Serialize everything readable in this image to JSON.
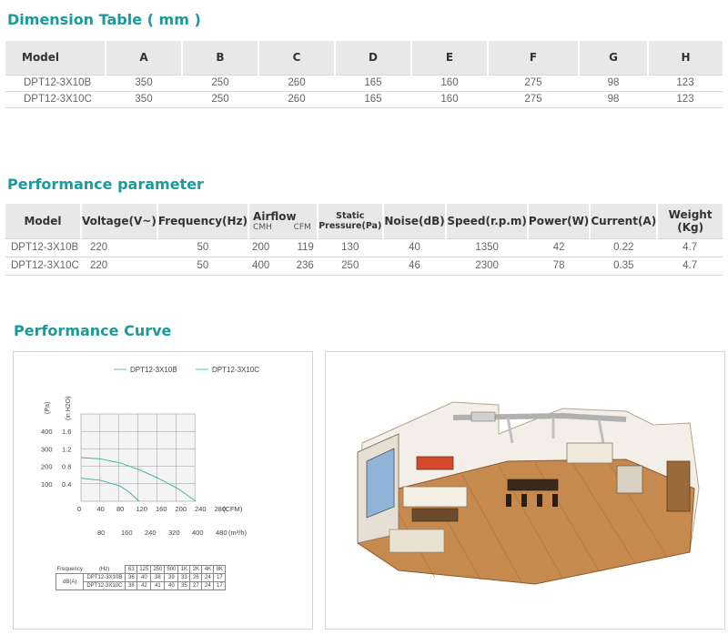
{
  "dimension": {
    "title": "Dimension Table ( mm )",
    "headers": [
      "Model",
      "A",
      "B",
      "C",
      "D",
      "E",
      "F",
      "G",
      "H"
    ],
    "rows": [
      [
        "DPT12-3X10B",
        "350",
        "250",
        "260",
        "165",
        "160",
        "275",
        "98",
        "123"
      ],
      [
        "DPT12-3X10C",
        "350",
        "250",
        "260",
        "165",
        "160",
        "275",
        "98",
        "123"
      ]
    ]
  },
  "performance": {
    "title": "Performance parameter",
    "headers": {
      "model": "Model",
      "voltage": "Voltage(V~)",
      "frequency": "Frequency(Hz)",
      "airflow": "Airflow",
      "airflow_cmh": "CMH",
      "airflow_cfm": "CFM",
      "static_top": "Static",
      "static_bottom": "Pressure(Pa)",
      "noise": "Noise(dB)",
      "speed": "Speed(r.p.m)",
      "power": "Power(W)",
      "current": "Current(A)",
      "weight": "Weight (Kg)"
    },
    "rows": [
      [
        "DPT12-3X10B",
        "220",
        "50",
        "200",
        "119",
        "130",
        "40",
        "1350",
        "42",
        "0.22",
        "4.7"
      ],
      [
        "DPT12-3X10C",
        "220",
        "50",
        "400",
        "236",
        "250",
        "46",
        "2300",
        "78",
        "0.35",
        "4.7"
      ]
    ]
  },
  "curve": {
    "title": "Performance Curve"
  },
  "chart_data": {
    "type": "line",
    "legend": [
      "DPT12-3X10B",
      "DPT12-3X10C"
    ],
    "legend_position": "top-right",
    "y_unit_pa": "(Pa)",
    "y_unit_inh2o": "(in H2O)",
    "y_ticks_pa": [
      "400",
      "300",
      "200",
      "100"
    ],
    "y_ticks_inh2o": [
      "1.6",
      "1.2",
      "0.8",
      "0.4"
    ],
    "x_ticks_cfm": [
      "0",
      "40",
      "80",
      "120",
      "160",
      "200",
      "240",
      "280"
    ],
    "x_unit_cfm": "(CFM)",
    "x_ticks_m3h": [
      "80",
      "160",
      "240",
      "320",
      "400",
      "480"
    ],
    "x_unit_m3h": "(m³/h)",
    "xlim_cfm": [
      0,
      280
    ],
    "ylim_inh2o": [
      0,
      2.0
    ],
    "grid": true,
    "series": [
      {
        "name": "DPT12-3X10B",
        "x": [
          0,
          40,
          80,
          100,
          119
        ],
        "y": [
          0.53,
          0.48,
          0.35,
          0.2,
          0.0
        ],
        "color": "#3aaea3"
      },
      {
        "name": "DPT12-3X10C",
        "x": [
          0,
          40,
          80,
          120,
          160,
          200,
          236
        ],
        "y": [
          1.0,
          0.97,
          0.88,
          0.72,
          0.52,
          0.28,
          0.0
        ],
        "color": "#3aaea3"
      }
    ],
    "noise_table": {
      "frequency_label": "Frequency",
      "unit_label": "(Hz)",
      "dba_label": "dB(A)",
      "frequencies": [
        "63",
        "125",
        "250",
        "500",
        "1K",
        "2K",
        "4K",
        "8K"
      ],
      "rows": [
        {
          "model": "DPT12-3X10B",
          "values": [
            "36",
            "40",
            "38",
            "39",
            "33",
            "26",
            "24",
            "17"
          ]
        },
        {
          "model": "DPT12-3X10C",
          "values": [
            "38",
            "42",
            "41",
            "40",
            "35",
            "27",
            "24",
            "17"
          ]
        }
      ]
    }
  },
  "colors": {
    "heading": "#1a9a9a",
    "header_bg": "#e8e8e8",
    "curve": "#3aaea3",
    "panel_border": "#d5d5d5"
  }
}
